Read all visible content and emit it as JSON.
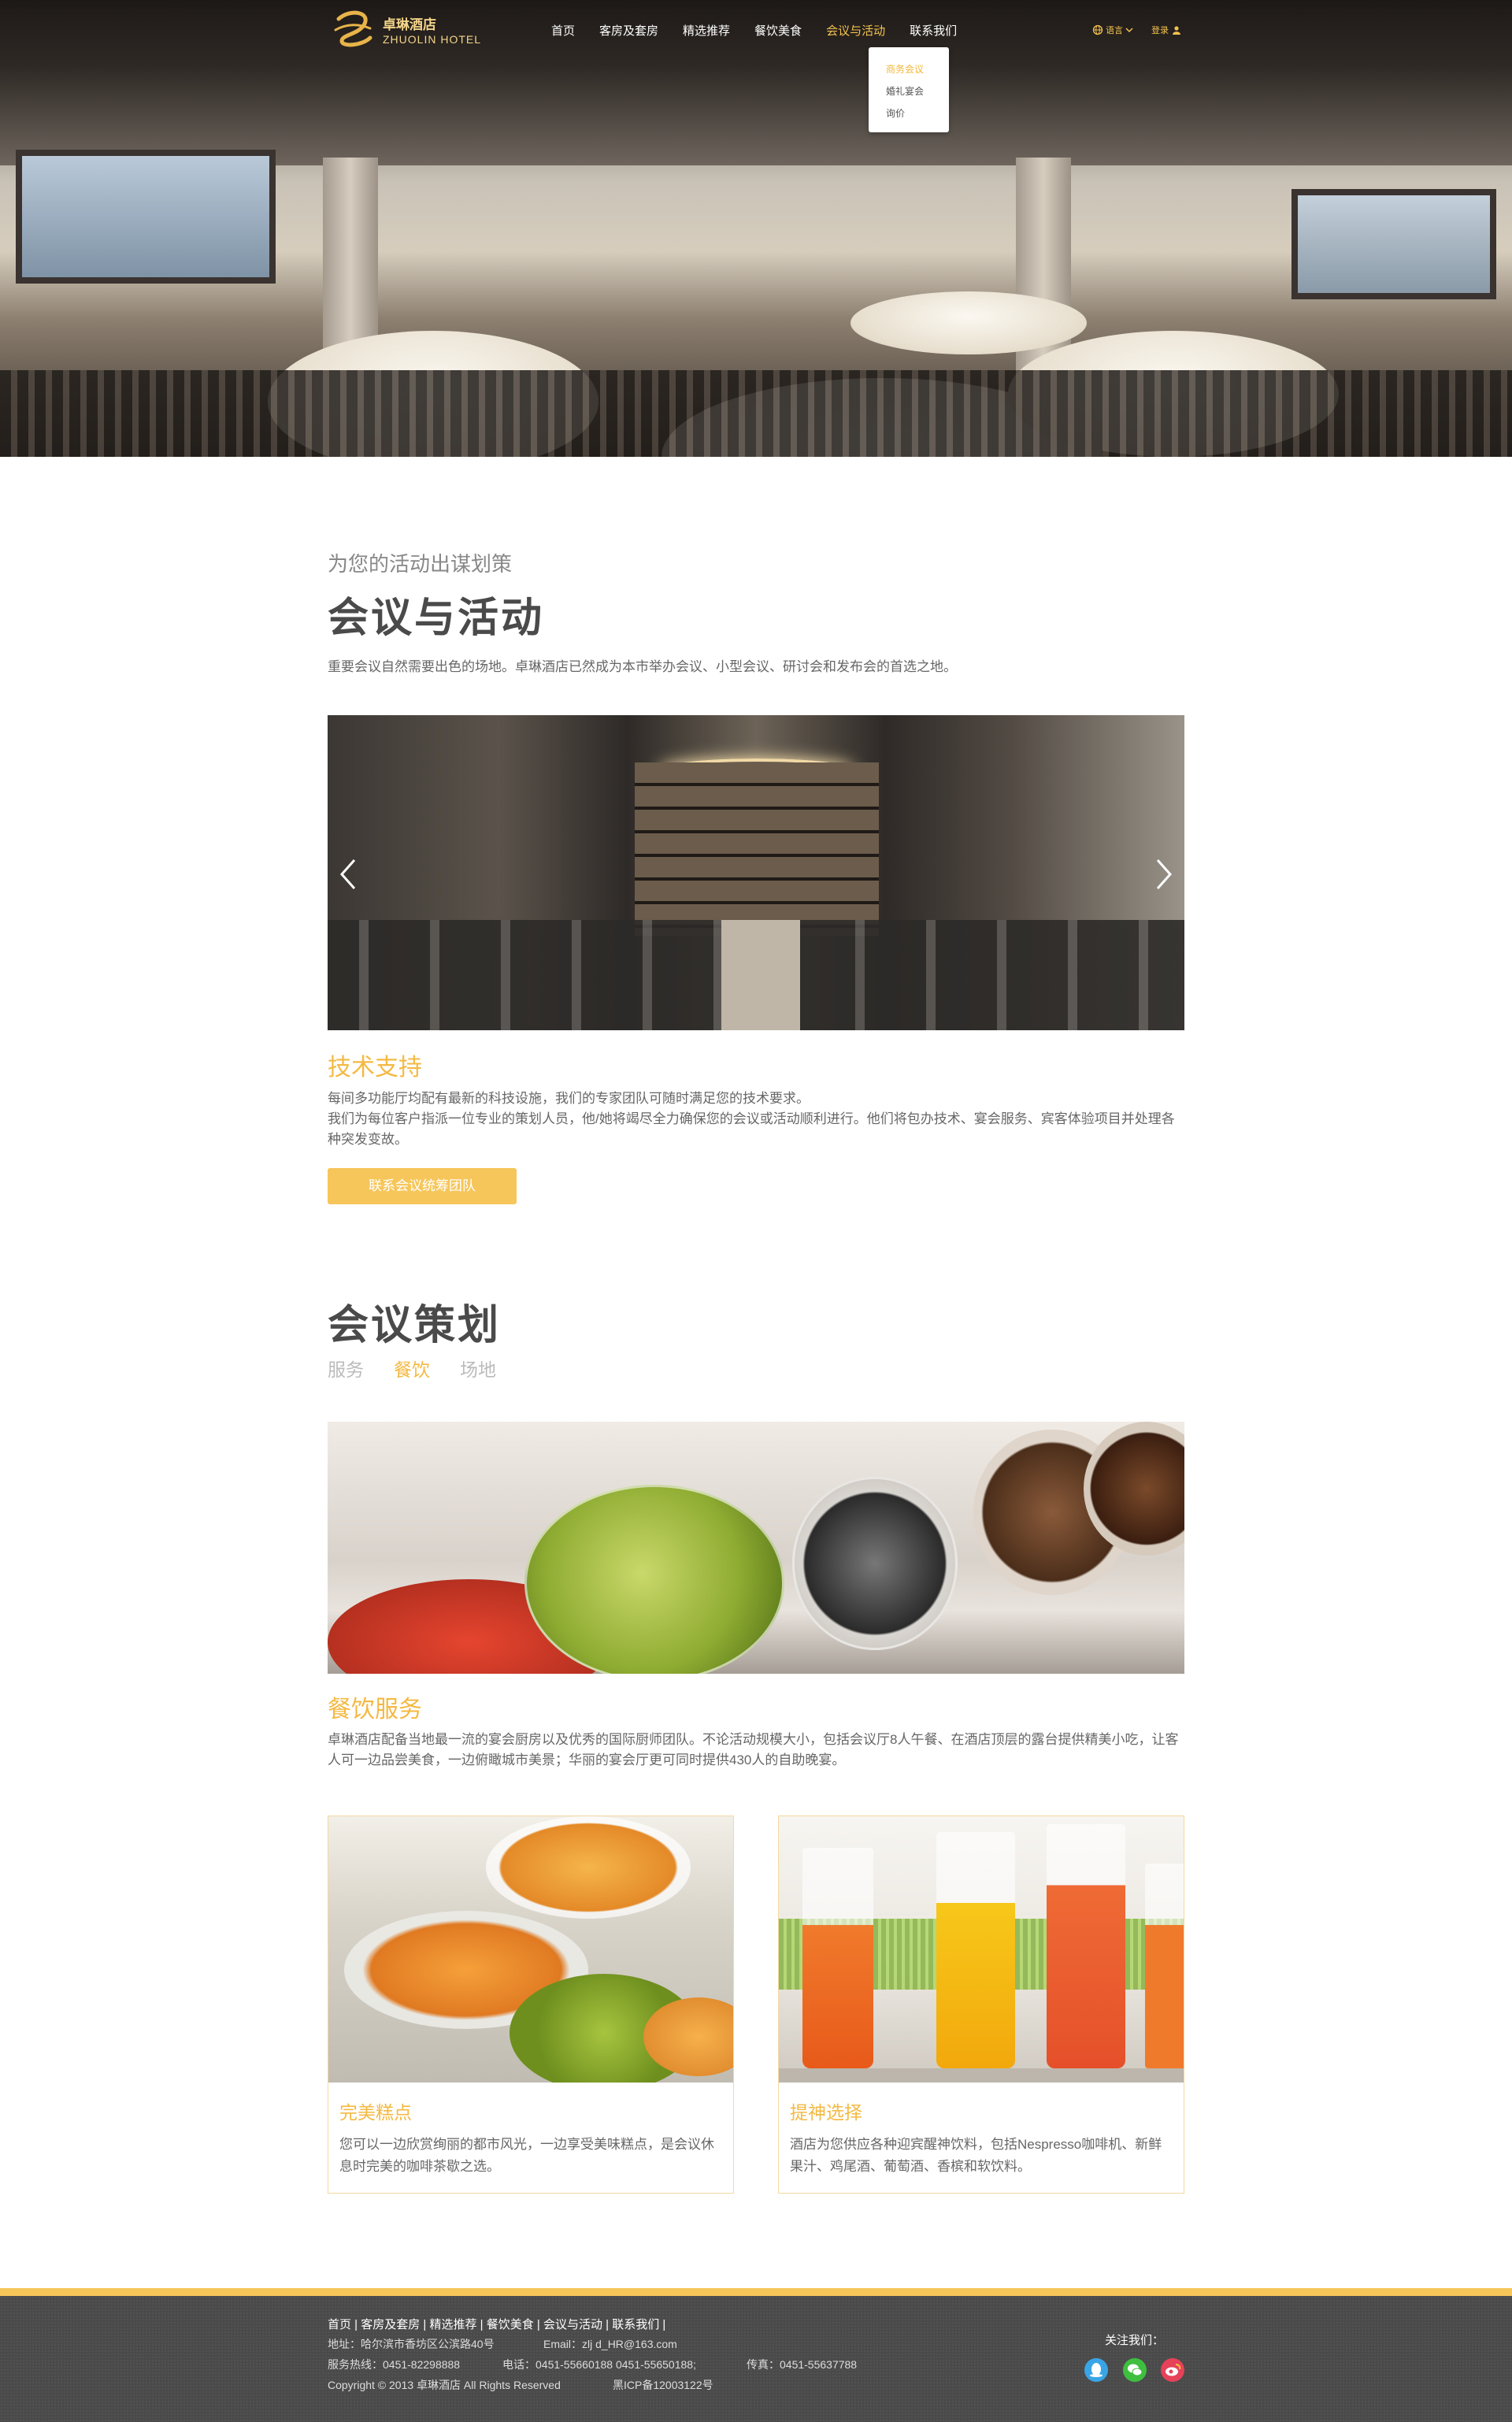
{
  "header": {
    "logo_cn": "卓琳酒店",
    "logo_en": "ZHUOLIN HOTEL",
    "nav": [
      {
        "label": "首页"
      },
      {
        "label": "客房及套房"
      },
      {
        "label": "精选推荐"
      },
      {
        "label": "餐饮美食"
      },
      {
        "label": "会议与活动"
      },
      {
        "label": "联系我们"
      }
    ],
    "dropdown": [
      "商务会议",
      "婚礼宴会",
      "询价"
    ],
    "lang_label": "语言",
    "login_label": "登录"
  },
  "intro": {
    "subtitle": "为您的活动出谋划策",
    "title": "会议与活动",
    "desc": "重要会议自然需要出色的场地。卓琳酒店已然成为本市举办会议、小型会议、研讨会和发布会的首选之地。"
  },
  "tech": {
    "title": "技术支持",
    "p1": "每间多功能厅均配有最新的科技设施，我们的专家团队可随时满足您的技术要求。",
    "p2": "我们为每位客户指派一位专业的策划人员，他/她将竭尽全力确保您的会议或活动顺利进行。他们将包办技术、宴会服务、宾客体验项目并处理各种突发变故。",
    "button": "联系会议统筹团队"
  },
  "planning": {
    "title": "会议策划",
    "tabs": [
      "服务",
      "餐饮",
      "场地"
    ],
    "active_tab": "餐饮",
    "service_title": "餐饮服务",
    "service_desc": "卓琳酒店配备当地最一流的宴会厨房以及优秀的国际厨师团队。不论活动规模大小，包括会议厅8人午餐、在酒店顶层的露台提供精美小吃，让客人可一边品尝美食，一边俯瞰城市美景；华丽的宴会厅更可同时提供430人的自助晚宴。",
    "cards": [
      {
        "title": "完美糕点",
        "desc": "您可以一边欣赏绚丽的都市风光，一边享受美味糕点，是会议休息时完美的咖啡茶歇之选。"
      },
      {
        "title": "提神选择",
        "desc": "酒店为您供应各种迎宾醒神饮料，包括Nespresso咖啡机、新鲜果汁、鸡尾酒、葡萄酒、香槟和软饮料。"
      }
    ]
  },
  "footer": {
    "links": [
      "首页",
      "客房及套房",
      "精选推荐",
      "餐饮美食",
      "会议与活动",
      "联系我们"
    ],
    "address": "地址：哈尔滨市香坊区公滨路40号",
    "email": "Email：zlj d_HR@163.com",
    "hotline": "服务热线：0451-82298888",
    "phone": "电话：0451-55660188   0451-55650188;",
    "fax": "传真：0451-55637788",
    "copyright": "Copyright © 2013 卓琳酒店 All Rights Reserved",
    "icp": "黑ICP备12003122号",
    "follow": "关注我们："
  },
  "colors": {
    "accent": "#f4b942",
    "button": "#f6c65a",
    "footer": "#4a4a4a"
  }
}
